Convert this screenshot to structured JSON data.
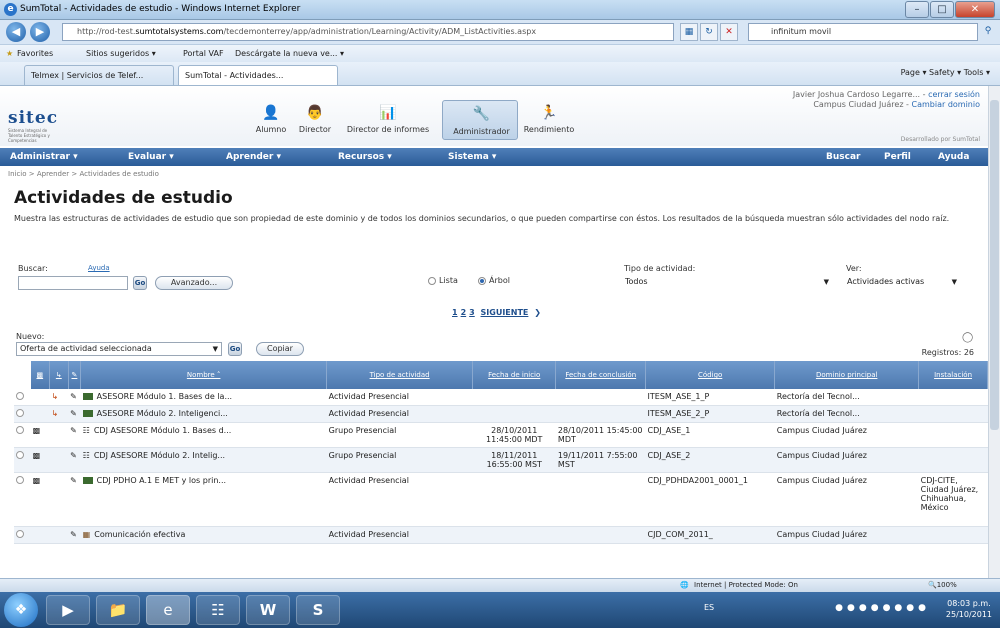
{
  "window": {
    "title": "SumTotal - Actividades de estudio - Windows Internet Explorer",
    "min": "–",
    "max": "□",
    "close": "✕"
  },
  "address": {
    "url_prefix": "http://rod-test.",
    "url_domain": "sumtotalsystems.com",
    "url_rest": "/tecdemonterrey/app/administration/Learning/Activity/ADM_ListActivities.aspx",
    "search_text": "infinitum movil"
  },
  "favorites": {
    "label": "Favorites",
    "items": [
      "Sitios sugeridos ▾",
      "Portal VAF",
      "Descárgate la nueva ve... ▾"
    ]
  },
  "tabs": [
    "Telmex | Servicios de Telef...",
    "SumTotal - Actividades..."
  ],
  "command_bar": "Page ▾   Safety ▾   Tools ▾",
  "header": {
    "logo_text": "sitec",
    "logo_sub": "Sistema Integral de Talento Estratégico y Competencias",
    "roles": [
      {
        "label": "Alumno",
        "icon": "student-icon",
        "glyph": "👤"
      },
      {
        "label": "Director",
        "icon": "director-icon",
        "glyph": "👨"
      },
      {
        "label": "Director de informes",
        "icon": "report-icon",
        "glyph": "📊"
      },
      {
        "label": "Administrador",
        "icon": "admin-icon",
        "glyph": "🔧"
      },
      {
        "label": "Rendimiento",
        "icon": "performance-icon",
        "glyph": "🏃"
      }
    ],
    "user_name": "Javier Joshua Cardoso Legarre...",
    "logout": "cerrar sesión",
    "campus": "Campus Ciudad Juárez",
    "change_domain": "Cambiar dominio",
    "developed_by": "Desarrollado por SumTotal"
  },
  "menu": {
    "items": [
      "Administrar ▾",
      "Evaluar ▾",
      "Aprender ▾",
      "Recursos ▾",
      "Sistema ▾"
    ],
    "right": [
      "Buscar",
      "Perfil",
      "Ayuda"
    ]
  },
  "breadcrumb": "Inicio > Aprender > Actividades de estudio",
  "page_title": "Actividades de estudio",
  "page_desc": "Muestra las estructuras de actividades de estudio que son propiedad de este dominio y de todos los dominios secundarios, o que pueden compartirse con éstos. Los resultados de la búsqueda muestran sólo actividades del nodo raíz.",
  "search": {
    "label": "Buscar:",
    "help": "Ayuda",
    "go": "Go",
    "advanced": "Avanzado...",
    "view_list": "Lista",
    "view_tree": "Árbol",
    "type_label": "Tipo de actividad:",
    "type_value": "Todos",
    "see_label": "Ver:",
    "see_value": "Actividades activas"
  },
  "pager": {
    "pages": [
      "1",
      "2",
      "3"
    ],
    "next": "SIGUIENTE"
  },
  "nuevo": {
    "label": "Nuevo:",
    "value": "Oferta de actividad seleccionada",
    "go": "Go",
    "copy": "Copiar"
  },
  "records": "Registros: 26",
  "table": {
    "headers": [
      "Nombre ˄",
      "Tipo de actividad",
      "Fecha de inicio",
      "Fecha de conclusión",
      "Código",
      "Dominio principal",
      "Instalación"
    ],
    "rows": [
      {
        "name": "ASESORE Módulo 1. Bases de la...",
        "type": "Actividad Presencial",
        "start": "",
        "end": "",
        "code": "ITESM_ASE_1_P",
        "domain": "Rectoría del Tecnol...",
        "inst": ""
      },
      {
        "name": "ASESORE Módulo 2. Inteligenci...",
        "type": "Actividad Presencial",
        "start": "",
        "end": "",
        "code": "ITESM_ASE_2_P",
        "domain": "Rectoría del Tecnol...",
        "inst": ""
      },
      {
        "name": "CDJ ASESORE Módulo 1. Bases d...",
        "type": "Grupo Presencial",
        "start": "28/10/2011 11:45:00 MDT",
        "end": "28/10/2011 15:45:00 MDT",
        "code": "CDJ_ASE_1",
        "domain": "Campus Ciudad Juárez",
        "inst": ""
      },
      {
        "name": "CDJ ASESORE Módulo 2. Intelig...",
        "type": "Grupo Presencial",
        "start": "18/11/2011 16:55:00 MST",
        "end": "19/11/2011 7:55:00 MST",
        "code": "CDJ_ASE_2",
        "domain": "Campus Ciudad Juárez",
        "inst": ""
      },
      {
        "name": "CDJ PDHO A.1 E MET y los prin...",
        "type": "Actividad Presencial",
        "start": "",
        "end": "",
        "code": "CDJ_PDHDA2001_0001_1",
        "domain": "Campus Ciudad Juárez",
        "inst": "CDJ-CITE, Ciudad Juárez, Chihuahua, México"
      },
      {
        "name": "Comunicación efectiva",
        "type": "Actividad Presencial",
        "start": "",
        "end": "",
        "code": "CJD_COM_2011_",
        "domain": "Campus Ciudad Juárez",
        "inst": ""
      }
    ]
  },
  "status": {
    "zone": "Internet | Protected Mode: On",
    "zoom": "🔍100%"
  },
  "taskbar": {
    "time": "08:03 p.m.",
    "date": "25/10/2011",
    "lang": "ES"
  }
}
